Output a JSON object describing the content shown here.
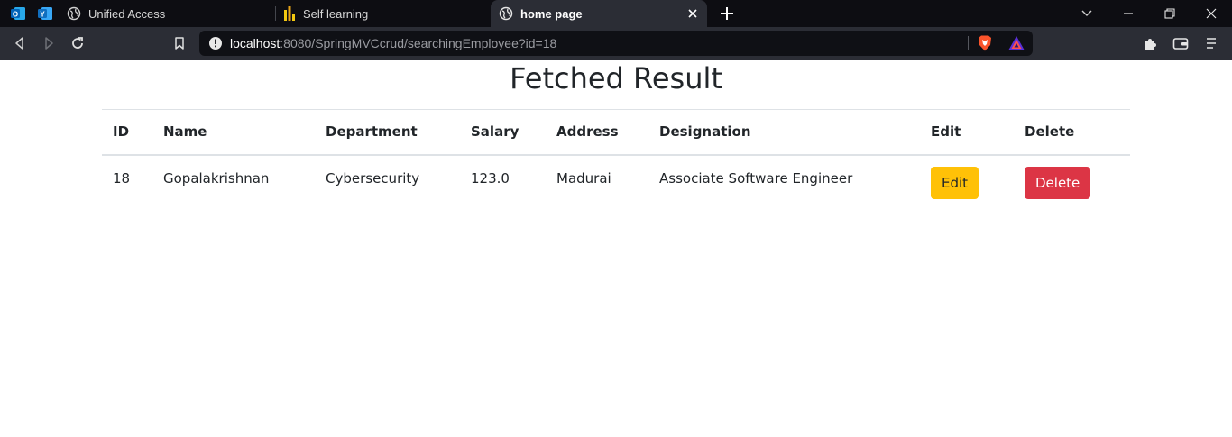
{
  "browser": {
    "tabs": [
      {
        "title": "Unified Access",
        "active": false
      },
      {
        "title": "Self learning",
        "active": false
      },
      {
        "title": "home page",
        "active": true
      }
    ],
    "url": {
      "host": "localhost",
      "rest": ":8080/SpringMVCcrud/searchingEmployee?id=18"
    },
    "colors": {
      "tabstrip": "#0d0d12",
      "toolbar": "#2b2d35",
      "omnibox": "#0f1015"
    }
  },
  "page": {
    "title": "Fetched Result",
    "table": {
      "headers": [
        "ID",
        "Name",
        "Department",
        "Salary",
        "Address",
        "Designation",
        "Edit",
        "Delete"
      ],
      "rows": [
        {
          "id": "18",
          "name": "Gopalakrishnan",
          "department": "Cybersecurity",
          "salary": "123.0",
          "address": "Madurai",
          "designation": "Associate Software Engineer",
          "edit_label": "Edit",
          "delete_label": "Delete"
        }
      ]
    },
    "colors": {
      "edit_button": "#ffc107",
      "delete_button": "#dc3545",
      "text": "#212529"
    }
  }
}
